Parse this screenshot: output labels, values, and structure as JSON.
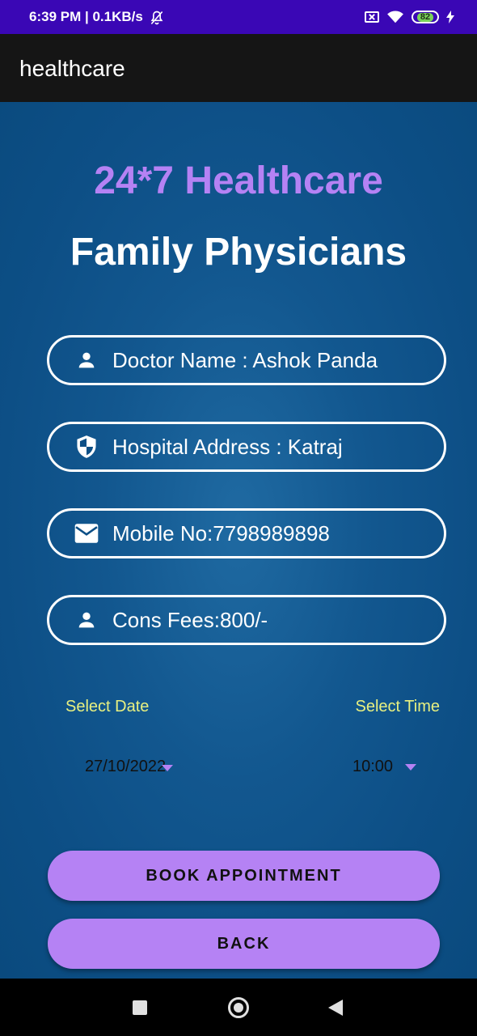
{
  "status_bar": {
    "time_speed": "6:39 PM | 0.1KB/s",
    "battery_level": "82"
  },
  "app_bar": {
    "title": "healthcare"
  },
  "header": {
    "brand": "24*7 Healthcare",
    "subtitle": "Family Physicians"
  },
  "fields": [
    {
      "icon": "person-icon",
      "text": "Doctor Name : Ashok Panda"
    },
    {
      "icon": "shield-icon",
      "text": "Hospital Address : Katraj"
    },
    {
      "icon": "mail-icon",
      "text": "Mobile No:7798989898"
    },
    {
      "icon": "person-icon",
      "text": "Cons Fees:800/-"
    }
  ],
  "date_picker": {
    "label": "Select Date",
    "value": "27/10/2022"
  },
  "time_picker": {
    "label": "Select Time",
    "value": "10:00"
  },
  "buttons": {
    "book": "BOOK APPOINTMENT",
    "back": "BACK"
  },
  "colors": {
    "status_bar": "#3a07b5",
    "app_bar": "#151515",
    "accent": "#b582f4",
    "label": "#e8f080",
    "background": "#0d4f86"
  }
}
